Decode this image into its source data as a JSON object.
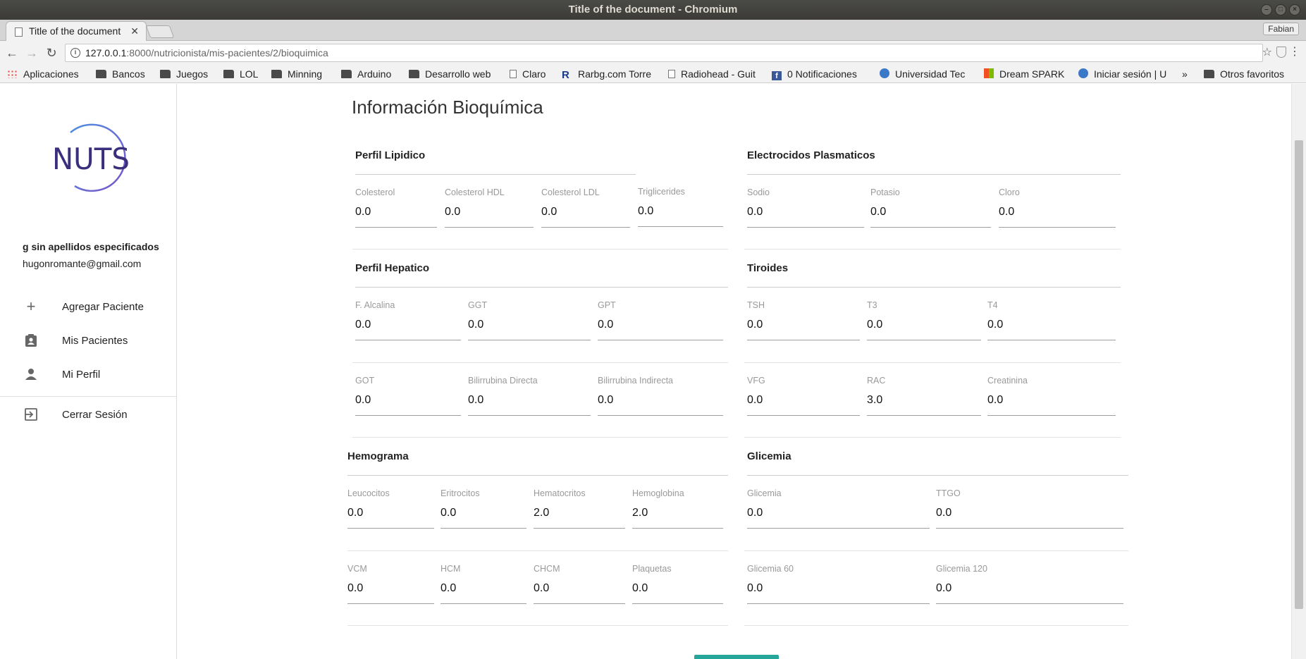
{
  "window": {
    "title": "Title of the document - Chromium",
    "profile": "Fabian"
  },
  "tab": {
    "label": "Title of the document"
  },
  "address": {
    "host": "127.0.0.1",
    "path": ":8000/nutricionista/mis-pacientes/2/bioquimica"
  },
  "bookmarks": [
    {
      "label": "Aplicaciones",
      "icon": "apps-icon"
    },
    {
      "label": "Bancos",
      "icon": "folder-icon"
    },
    {
      "label": "Juegos",
      "icon": "folder-icon"
    },
    {
      "label": "LOL",
      "icon": "folder-icon"
    },
    {
      "label": "Minning",
      "icon": "folder-icon"
    },
    {
      "label": "Arduino",
      "icon": "folder-icon"
    },
    {
      "label": "Desarrollo web",
      "icon": "folder-icon"
    },
    {
      "label": "Claro",
      "icon": "page-icon"
    },
    {
      "label": "Rarbg.com Torre",
      "icon": "rarbg-icon"
    },
    {
      "label": "Radiohead - Guit",
      "icon": "page-icon"
    },
    {
      "label": "0 Notificaciones",
      "icon": "facebook-icon"
    },
    {
      "label": "Universidad Tec",
      "icon": "utn-icon"
    },
    {
      "label": "Dream SPARK",
      "icon": "microsoft-icon"
    },
    {
      "label": "Iniciar sesión | U",
      "icon": "utn-icon"
    }
  ],
  "bookmarks_more": "»",
  "bookmarks_other": "Otros favoritos",
  "logo": {
    "text": "NUTS",
    "colors": [
      "#3a2f7c",
      "#4f8fe0",
      "#7b52c9"
    ]
  },
  "user": {
    "name": "g sin apellidos especificados",
    "email": "hugonromante@gmail.com"
  },
  "nav": [
    {
      "label": "Agregar Paciente",
      "icon": "plus-icon"
    },
    {
      "label": "Mis Pacientes",
      "icon": "clipboard-person-icon"
    },
    {
      "label": "Mi Perfil",
      "icon": "person-icon"
    },
    {
      "label": "Cerrar Sesión",
      "icon": "logout-icon"
    }
  ],
  "page": {
    "title": "Información Bioquímica"
  },
  "sections": {
    "perfil_lipidico": {
      "title": "Perfil Lipidico",
      "fields": [
        {
          "label": "Colesterol",
          "value": "0.0"
        },
        {
          "label": "Colesterol HDL",
          "value": "0.0"
        },
        {
          "label": "Colesterol LDL",
          "value": "0.0"
        },
        {
          "label": "Triglicerides",
          "value": "0.0"
        }
      ]
    },
    "electrocidos": {
      "title": "Electrocidos Plasmaticos",
      "fields": [
        {
          "label": "Sodio",
          "value": "0.0"
        },
        {
          "label": "Potasio",
          "value": "0.0"
        },
        {
          "label": "Cloro",
          "value": "0.0"
        }
      ]
    },
    "perfil_hepatico": {
      "title": "Perfil Hepatico",
      "fields": [
        {
          "label": "F. Alcalina",
          "value": "0.0"
        },
        {
          "label": "GGT",
          "value": "0.0"
        },
        {
          "label": "GPT",
          "value": "0.0"
        },
        {
          "label": "GOT",
          "value": "0.0"
        },
        {
          "label": "Bilirrubina Directa",
          "value": "0.0"
        },
        {
          "label": "Bilirrubina Indirecta",
          "value": "0.0"
        }
      ]
    },
    "tiroides": {
      "title": "Tiroides",
      "fields": [
        {
          "label": "TSH",
          "value": "0.0"
        },
        {
          "label": "T3",
          "value": "0.0"
        },
        {
          "label": "T4",
          "value": "0.0"
        },
        {
          "label": "VFG",
          "value": "0.0"
        },
        {
          "label": "RAC",
          "value": "3.0"
        },
        {
          "label": "Creatinina",
          "value": "0.0"
        }
      ]
    },
    "hemograma": {
      "title": "Hemograma",
      "fields": [
        {
          "label": "Leucocitos",
          "value": "0.0"
        },
        {
          "label": "Eritrocitos",
          "value": "0.0"
        },
        {
          "label": "Hematocritos",
          "value": "2.0"
        },
        {
          "label": "Hemoglobina",
          "value": "2.0"
        },
        {
          "label": "VCM",
          "value": "0.0"
        },
        {
          "label": "HCM",
          "value": "0.0"
        },
        {
          "label": "CHCM",
          "value": "0.0"
        },
        {
          "label": "Plaquetas",
          "value": "0.0"
        }
      ]
    },
    "glicemia": {
      "title": "Glicemia",
      "fields": [
        {
          "label": "Glicemia",
          "value": "0.0"
        },
        {
          "label": "TTGO",
          "value": "0.0"
        },
        {
          "label": "Glicemia 60",
          "value": "0.0"
        },
        {
          "label": "Glicemia 120",
          "value": "0.0"
        }
      ]
    }
  },
  "colors": {
    "accent": "#26a69a",
    "logo_text": "#3a2f7c"
  }
}
